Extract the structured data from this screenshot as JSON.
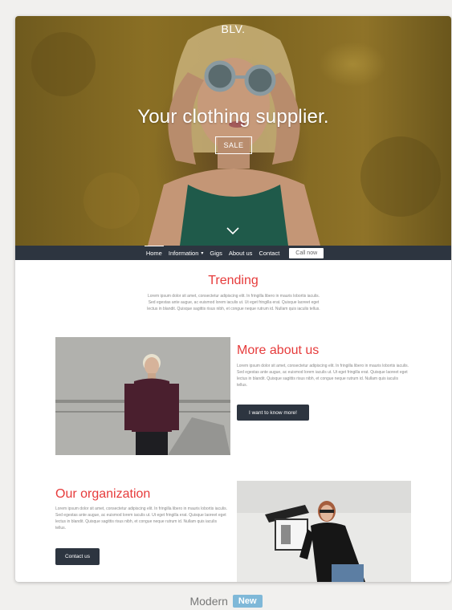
{
  "hero": {
    "logo": "BLV.",
    "title": "Your clothing supplier.",
    "sale_label": "SALE"
  },
  "nav": {
    "items": [
      {
        "label": "Home",
        "active": true
      },
      {
        "label": "Information",
        "has_dropdown": true
      },
      {
        "label": "Gigs"
      },
      {
        "label": "About us"
      },
      {
        "label": "Contact"
      }
    ],
    "call_label": "Call now"
  },
  "trending": {
    "title": "Trending",
    "text": "Lorem ipsum dolor sit amet, consectetur adipiscing elit. In fringilla libero in mauris lobortis iaculis. Sed egestas ante augue, ac euismod lorem iaculis ut. Ut eget fringilla erat. Quisque laoreet eget lectus in blandit. Quisque sagittis risus nibh, et congue neque rutrum id. Nullam quis iaculis tellus."
  },
  "about": {
    "title": "More about us",
    "text": "Lorem ipsum dolor sit amet, consectetur adipiscing elit. In fringilla libero in mauris lobortis iaculis. Sed egestas ante augue, ac euismod lorem iaculis ut. Ut eget fringilla erat. Quisque laoreet eget lectus in blandit. Quisque sagittis risus nibh, et congue neque rutrum id. Nullam quis iaculis tellus.",
    "button": "I want to know more!"
  },
  "organization": {
    "title": "Our organization",
    "text": "Lorem ipsum dolor sit amet, consectetur adipiscing elit. In fringilla libero in mauris lobortis iaculis. Sed egestas ante augue, ac euismod lorem iaculis ut. Ut eget fringilla erat. Quisque laoreet eget lectus in blandit. Quisque sagittis risus nibh, et congue neque rutrum id. Nullam quis iaculis tellus.",
    "button": "Contact us"
  },
  "theme": {
    "name": "Modern",
    "badge": "New"
  },
  "colors": {
    "accent": "#e63b3b",
    "nav_bg": "#2d3540",
    "badge_bg": "#7fb8d8"
  }
}
